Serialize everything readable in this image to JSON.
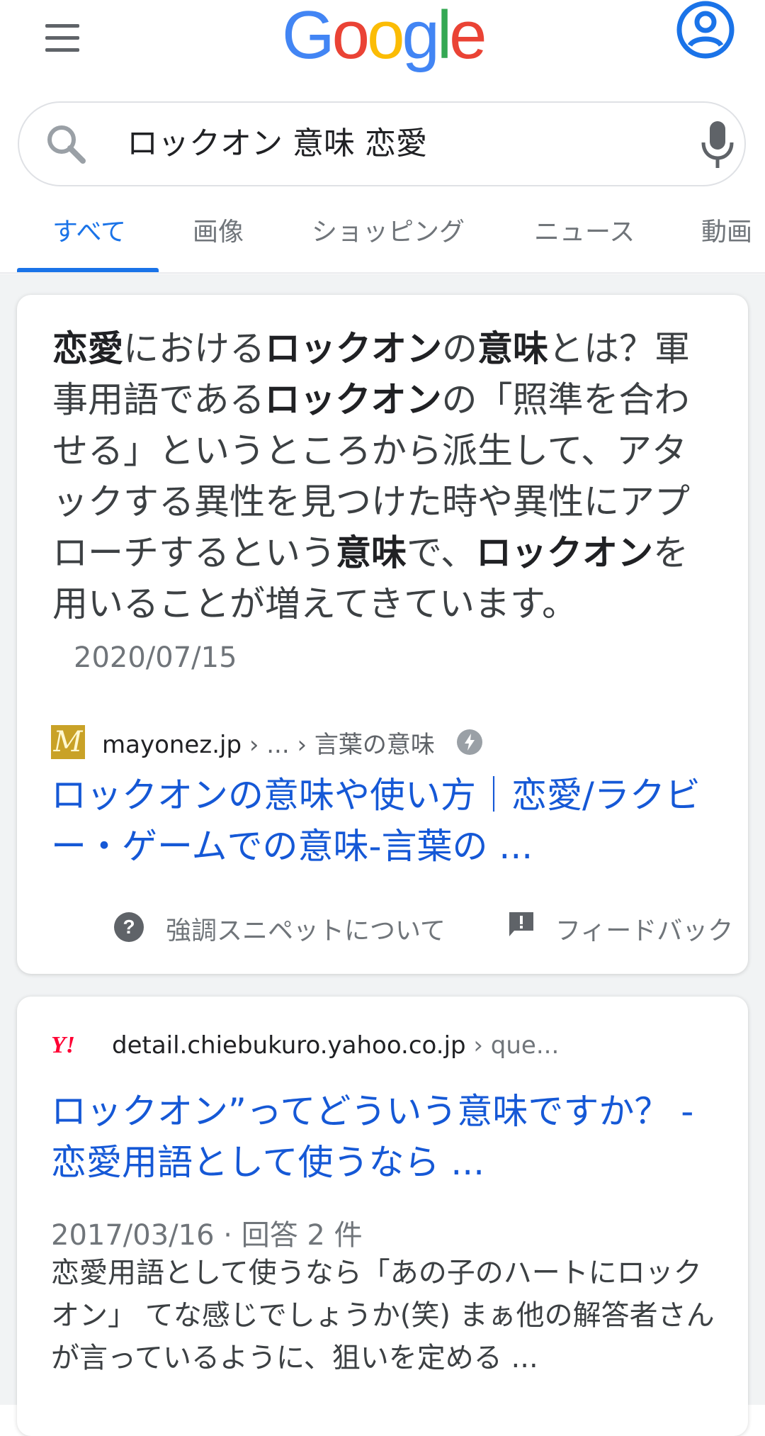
{
  "header": {
    "logo_letters": [
      "G",
      "o",
      "o",
      "g",
      "l",
      "e"
    ],
    "menu_icon": "hamburger-menu-icon",
    "account_icon": "account-circle-icon"
  },
  "search": {
    "query": "ロックオン 意味 恋愛",
    "search_icon": "search-icon",
    "mic_icon": "microphone-icon"
  },
  "tabs": [
    {
      "label": "すべて",
      "active": true
    },
    {
      "label": "画像"
    },
    {
      "label": "ショッピング"
    },
    {
      "label": "ニュース"
    },
    {
      "label": "動画"
    }
  ],
  "featured": {
    "snippet_parts": [
      {
        "t": "恋愛",
        "b": true
      },
      {
        "t": "における"
      },
      {
        "t": "ロックオン",
        "b": true
      },
      {
        "t": "の"
      },
      {
        "t": "意味",
        "b": true
      },
      {
        "t": "とは？軍事用語である"
      },
      {
        "t": "ロックオン",
        "b": true
      },
      {
        "t": "の「照準を合わせる」というところから派生して、アタックする異性を見つけた時や異性にアプローチするという"
      },
      {
        "t": "意味",
        "b": true
      },
      {
        "t": "で、"
      },
      {
        "t": "ロックオン",
        "b": true
      },
      {
        "t": "を用いることが増えてきています。"
      }
    ],
    "date": "2020/07/15",
    "source_domain": "mayonez.jp",
    "source_path": " › ... › 言葉の意味",
    "favicon_letter": "M",
    "title": "ロックオンの意味や使い方｜恋愛/ラクビー・ゲームでの意味-言葉の ...",
    "about_label": "強調スニペットについて",
    "feedback_label": "フィードバック"
  },
  "result2": {
    "favicon_text": "Y!",
    "source_domain": "detail.chiebukuro.yahoo.co.jp",
    "source_path": " › que...",
    "title": "ロックオン”ってどういう意味ですか？ - 恋愛用語として使うなら ...",
    "meta": "2017/03/16 · 回答 2 件",
    "description": "恋愛用語として使うなら「あの子のハートにロックオン」 てな感じでしょうか(笑) まぁ他の解答者さんが言っているように、狙いを定める ..."
  },
  "colors": {
    "link": "#1558d6",
    "accent": "#1a73e8",
    "google_blue": "#4285F4",
    "google_red": "#EA4335",
    "google_yellow": "#FBBC05",
    "google_green": "#34A853"
  }
}
